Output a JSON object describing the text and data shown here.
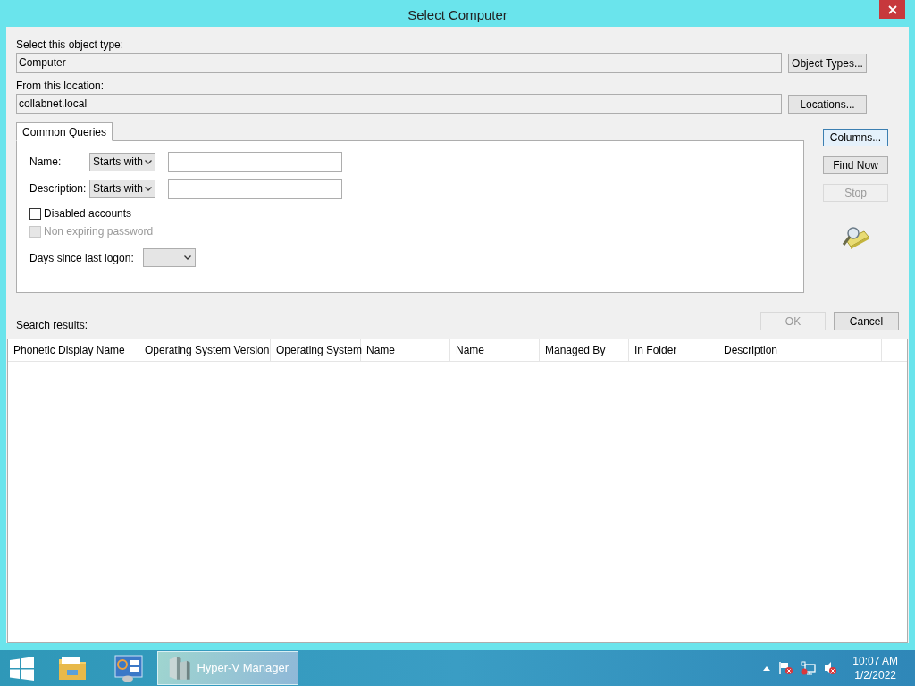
{
  "window": {
    "title": "Select Computer"
  },
  "object_type": {
    "label": "Select this object type:",
    "value": "Computer",
    "button": "Object Types..."
  },
  "location": {
    "label": "From this location:",
    "value": "collabnet.local",
    "button": "Locations..."
  },
  "tabs": [
    {
      "label": "Common Queries",
      "selected": true
    }
  ],
  "query_rows": [
    {
      "label": "Name:",
      "operator": "Starts with"
    },
    {
      "label": "Description:",
      "operator": "Starts with"
    }
  ],
  "checkboxes": [
    {
      "label": "Disabled accounts",
      "checked": false,
      "disabled": false
    },
    {
      "label": "Non expiring password",
      "checked": false,
      "disabled": true
    }
  ],
  "days_since_logon": {
    "label": "Days since last logon:"
  },
  "side_buttons": [
    {
      "label": "Columns...",
      "focused": true,
      "disabled": false
    },
    {
      "label": "Find Now",
      "focused": false,
      "disabled": false
    },
    {
      "label": "Stop",
      "focused": false,
      "disabled": true
    }
  ],
  "search_results": {
    "label": "Search results:"
  },
  "dialog_buttons": [
    {
      "label": "OK",
      "disabled": true
    },
    {
      "label": "Cancel",
      "disabled": false
    }
  ],
  "table": {
    "columns": [
      "Phonetic Display Name",
      "Operating System Version",
      "Operating System",
      "Name",
      "Name",
      "Managed By",
      "In Folder",
      "Description"
    ]
  },
  "taskbar": {
    "items": [
      {
        "kind": "start",
        "selected": false
      },
      {
        "kind": "explorer",
        "selected": false
      },
      {
        "kind": "control",
        "selected": false
      },
      {
        "kind": "app",
        "label": "Hyper-V Manager",
        "selected": true
      }
    ],
    "tray": {
      "time": "10:07 AM",
      "date": "1/2/2022"
    }
  }
}
